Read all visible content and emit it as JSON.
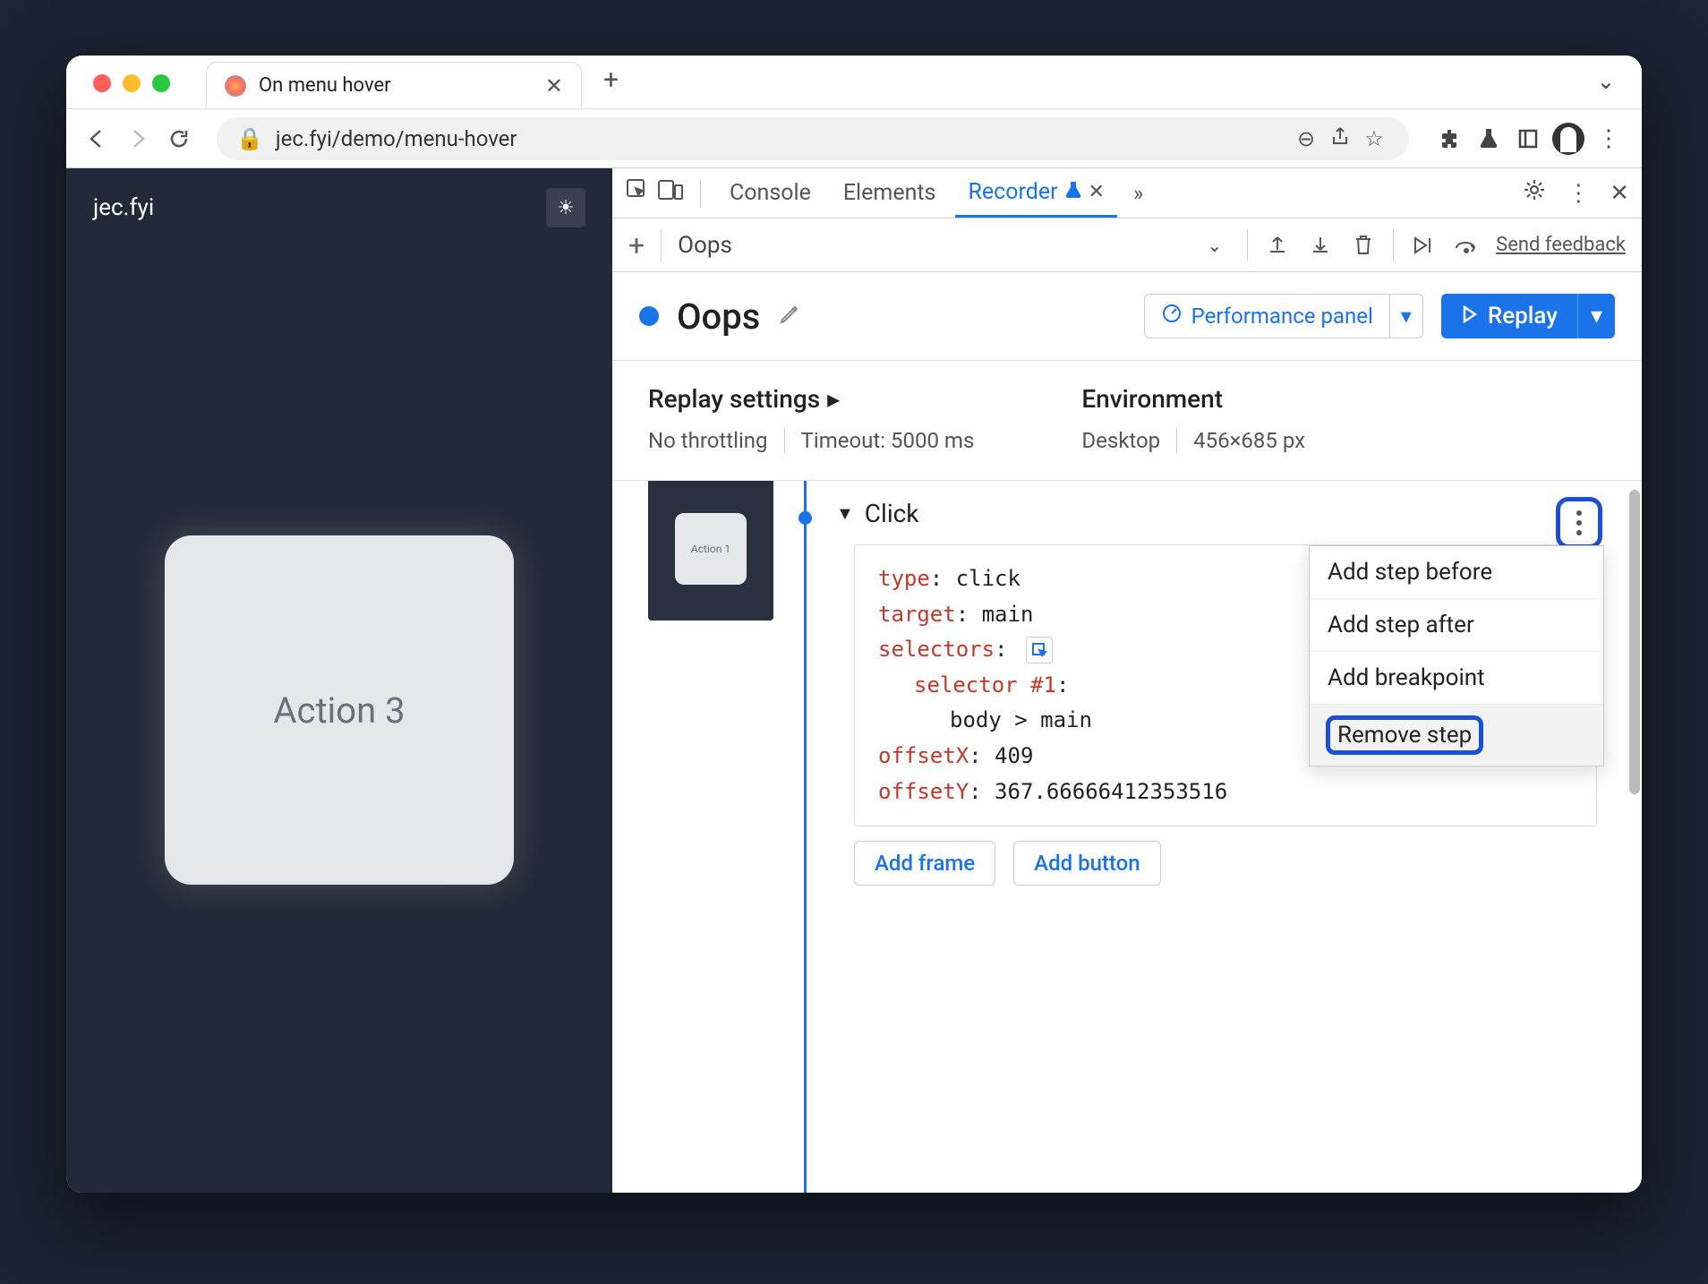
{
  "browser": {
    "tab_title": "On menu hover",
    "url": "jec.fyi/demo/menu-hover"
  },
  "page": {
    "site_name": "jec.fyi",
    "card_label": "Action 3",
    "thumb_label": "Action 1"
  },
  "devtools": {
    "tabs": {
      "console": "Console",
      "elements": "Elements",
      "recorder": "Recorder"
    },
    "toolbar": {
      "recording_name": "Oops",
      "send_feedback": "Send feedback"
    },
    "header": {
      "title": "Oops",
      "perf_panel": "Performance panel",
      "replay": "Replay"
    },
    "settings": {
      "replay_heading": "Replay settings",
      "throttling": "No throttling",
      "timeout": "Timeout: 5000 ms",
      "env_heading": "Environment",
      "device": "Desktop",
      "viewport": "456×685 px"
    },
    "step": {
      "name": "Click",
      "type_k": "type",
      "type_v": ": click",
      "target_k": "target",
      "target_v": ": main",
      "selectors_k": "selectors",
      "selectors_v": ":",
      "sel1_k": "selector #1",
      "sel1_v": ":",
      "sel_body": "body > main",
      "ox_k": "offsetX",
      "ox_v": ": 409",
      "oy_k": "offsetY",
      "oy_v": ": 367.66666412353516",
      "add_frame": "Add frame",
      "add_button": "Add button"
    },
    "menu": {
      "before": "Add step before",
      "after": "Add step after",
      "bp": "Add breakpoint",
      "remove": "Remove step"
    }
  }
}
